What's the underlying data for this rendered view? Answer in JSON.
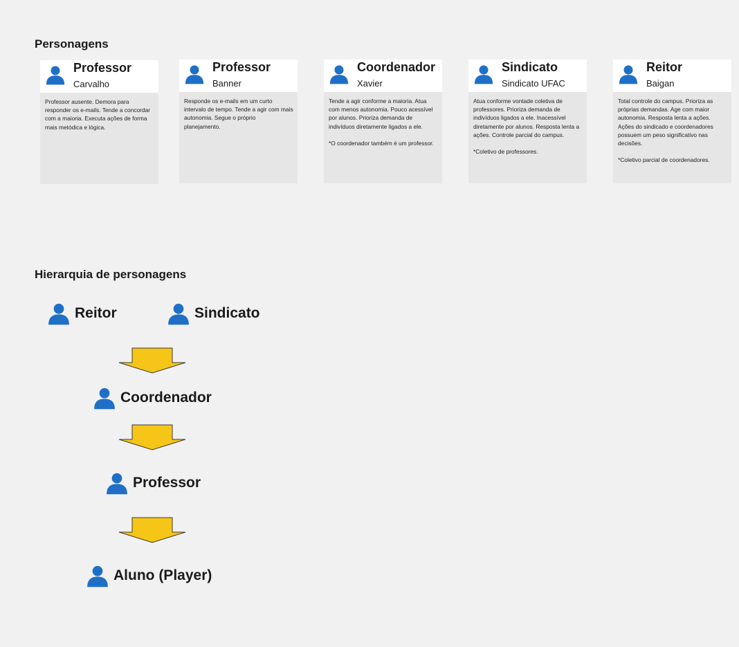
{
  "icons": {
    "person": "person-icon",
    "arrow": "down-arrow",
    "arrow_color": "#f5c518",
    "person_color": "#1f6fc7"
  },
  "personagens": {
    "title": "Personagens",
    "cards": [
      {
        "name": "Professor",
        "subtitle": "Carvalho",
        "description": "Professor ausente. Demora para responder os e-mails. Tende a concordar com a maioria. Executa ações de forma mais metódica e lógica."
      },
      {
        "name": "Professor",
        "subtitle": "Banner",
        "description": "Responde os e-mails em um curto intervalo de tempo. Tende a agir com mais autonomia. Segue o próprio planejamento."
      },
      {
        "name": "Coordenador",
        "subtitle": "Xavier",
        "description": "Tende a agir conforme a maioria. Atua com menos autonomia. Pouco acessível por alunos. Prioriza demanda de indivíduos diretamente ligados a ele.\n\n*O coordenador também é um professor."
      },
      {
        "name": "Sindicato",
        "subtitle": "Sindicato UFAC",
        "description": "Atua conforme vontade coletiva de professores. Prioriza demanda de indivíduos ligados a ele. Inacessível diretamente por alunos. Resposta lenta a ações. Controle parcial do campus.\n\n*Coletivo de professores."
      },
      {
        "name": "Reitor",
        "subtitle": "Baigan",
        "description": "Total controle do campus. Prioriza as próprias demandas. Age com maior autonomia. Resposta lenta a ações. Ações do sindicado e coordenadores possuem um peso significativo nas decisões.\n\n*Coletivo parcial de coordenadores."
      }
    ]
  },
  "hierarquia": {
    "title": "Hierarquia de personagens",
    "nodes": {
      "reitor": "Reitor",
      "sindicato": "Sindicato",
      "coordenador": "Coordenador",
      "professor": "Professor",
      "aluno": "Aluno (Player)"
    }
  }
}
